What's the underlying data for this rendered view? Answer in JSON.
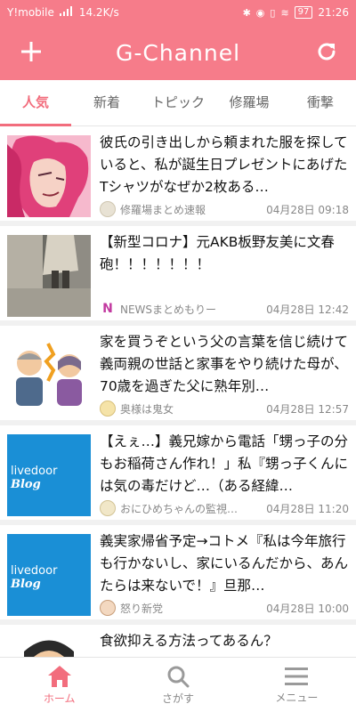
{
  "status_bar": {
    "carrier": "Y!mobile",
    "network": "4G",
    "speed": "14.2K/s",
    "battery": "97",
    "time": "21:26"
  },
  "header": {
    "title": "G-Channel"
  },
  "tabs": [
    {
      "label": "人気",
      "active": true
    },
    {
      "label": "新着",
      "active": false
    },
    {
      "label": "トピック",
      "active": false
    },
    {
      "label": "修羅場",
      "active": false
    },
    {
      "label": "衝撃",
      "active": false
    }
  ],
  "articles": [
    {
      "title": "彼氏の引き出しから頼まれた服を探していると、私が誕生日プレゼントにあげたTシャツがなぜか2枚ある…",
      "source": "修羅場まとめ速報",
      "date": "04月28日 09:18"
    },
    {
      "title": "【新型コロナ】元AKB板野友美に文春砲！！！！！！！",
      "source": "NEWSまとめもりー",
      "source_icon_text": "N",
      "date": "04月28日 12:42"
    },
    {
      "title": "家を買うぞという父の言葉を信じ続けて義両親の世話と家事をやり続けた母が、70歳を過ぎた父に熟年別…",
      "source": "奥様は鬼女",
      "date": "04月28日 12:57"
    },
    {
      "title": "【えぇ…】義兄嫁から電話「甥っ子の分もお稲荷さん作れ！」私『甥っ子くんには気の毒だけど…（ある経緯…",
      "source": "おにひめちゃんの監視…",
      "date": "04月28日 11:20",
      "thumb_text": "livedoor",
      "thumb_text2": "Blog"
    },
    {
      "title": "義実家帰省予定→コトメ『私は今年旅行も行かないし、家にいるんだから、あんたらは来ないで！』旦那…",
      "source": "怒り新党",
      "date": "04月28日 10:00",
      "thumb_text": "livedoor",
      "thumb_text2": "Blog"
    },
    {
      "title": "食欲抑える方法ってあるん？",
      "source": "",
      "date": ""
    }
  ],
  "bottom_nav": [
    {
      "label": "ホーム",
      "icon": "home-icon",
      "active": true
    },
    {
      "label": "さがす",
      "icon": "search-icon",
      "active": false
    },
    {
      "label": "メニュー",
      "icon": "menu-icon",
      "active": false
    }
  ],
  "colors": {
    "brand": "#f67c8a",
    "accent": "#f26d7d"
  }
}
